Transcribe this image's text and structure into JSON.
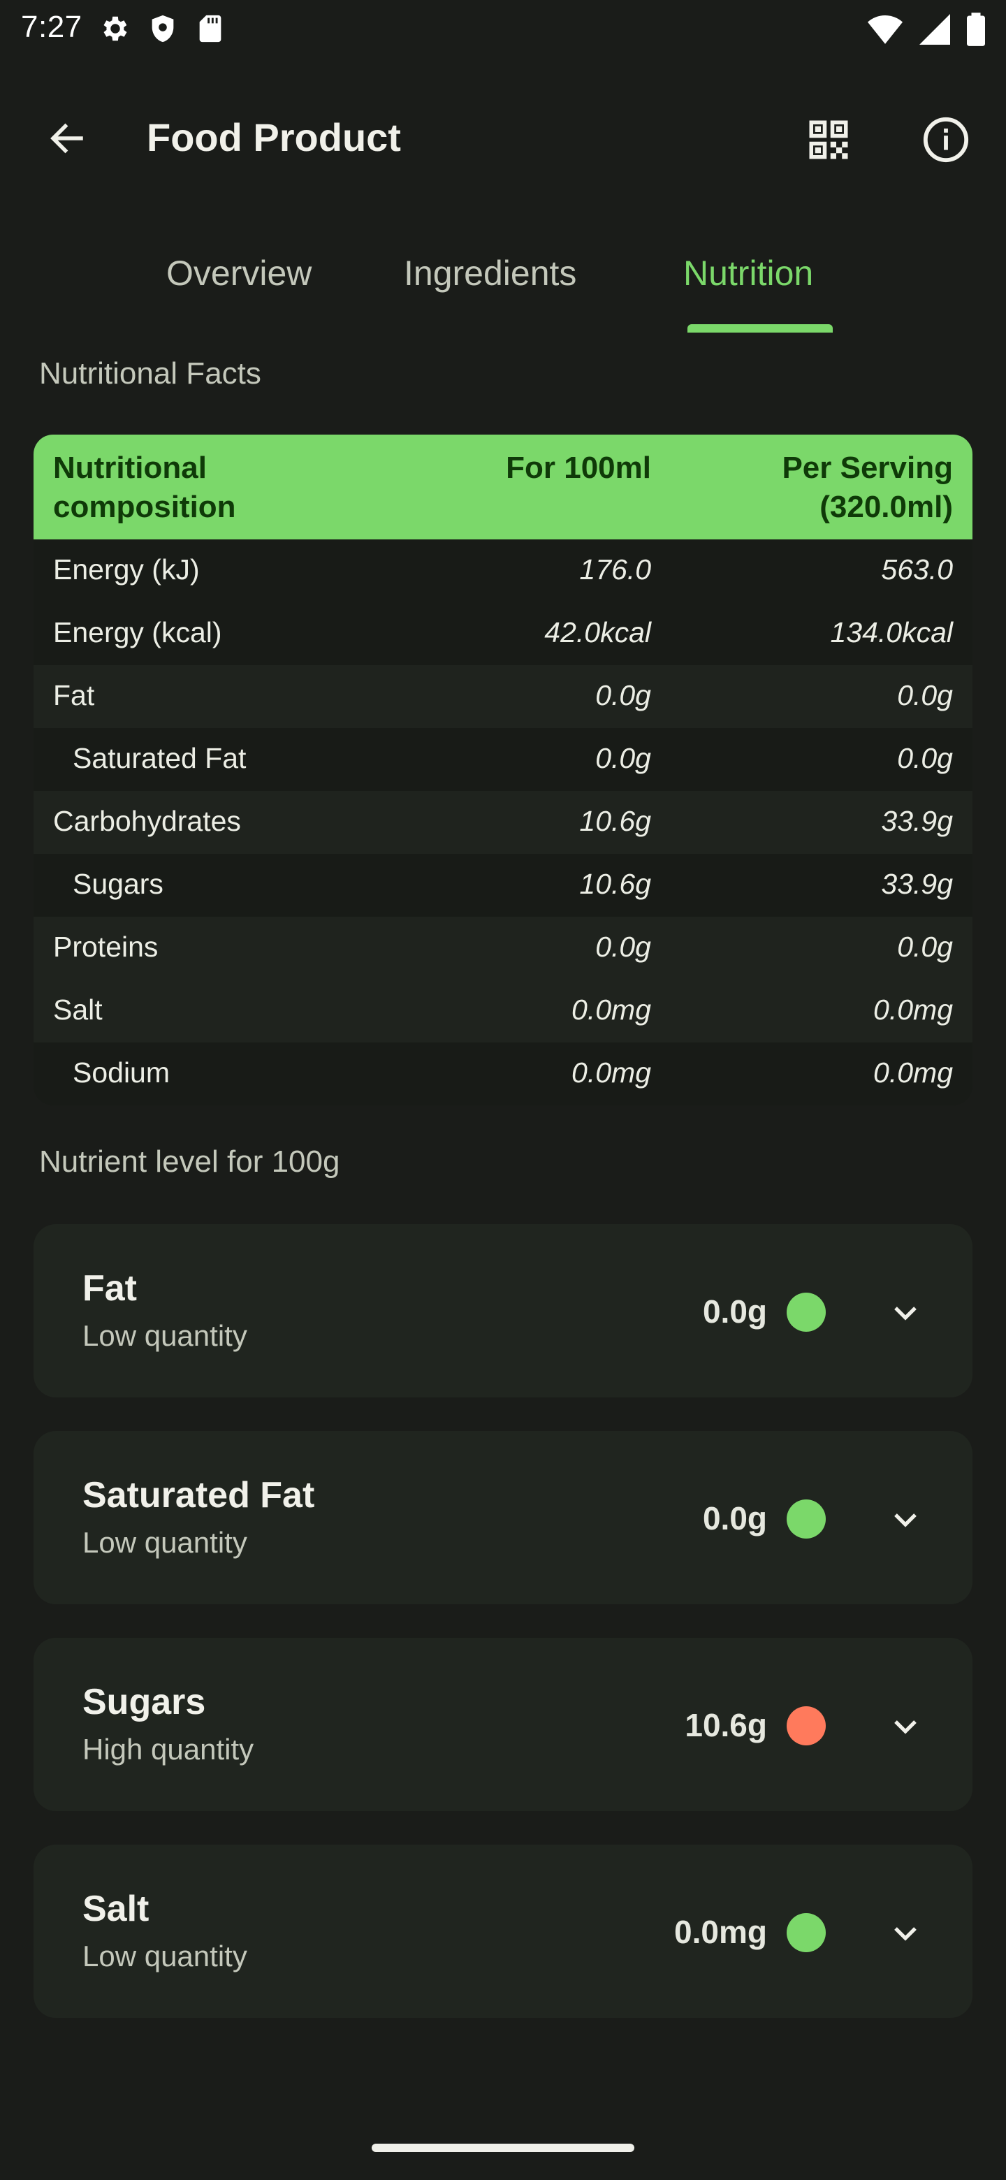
{
  "status_bar": {
    "time": "7:27"
  },
  "app_bar": {
    "title": "Food Product"
  },
  "tabs": [
    {
      "label": "Overview"
    },
    {
      "label": "Ingredients"
    },
    {
      "label": "Nutrition"
    }
  ],
  "active_tab": "Nutrition",
  "nutritional_facts": {
    "section_title": "Nutritional Facts",
    "columns": [
      "Nutritional\ncomposition",
      "For 100ml",
      "Per Serving\n(320.0ml)"
    ],
    "rows": [
      {
        "name": "Energy (kJ)",
        "per_100": "176.0",
        "per_serving": "563.0"
      },
      {
        "name": "Energy (kcal)",
        "per_100": "42.0kcal",
        "per_serving": "134.0kcal"
      },
      {
        "name": "Fat",
        "per_100": "0.0g",
        "per_serving": "0.0g"
      },
      {
        "name": "Saturated Fat",
        "per_100": "0.0g",
        "per_serving": "0.0g"
      },
      {
        "name": "Carbohydrates",
        "per_100": "10.6g",
        "per_serving": "33.9g"
      },
      {
        "name": "Sugars",
        "per_100": "10.6g",
        "per_serving": "33.9g"
      },
      {
        "name": "Proteins",
        "per_100": "0.0g",
        "per_serving": "0.0g"
      },
      {
        "name": "Salt",
        "per_100": "0.0mg",
        "per_serving": "0.0mg"
      },
      {
        "name": "Sodium",
        "per_100": "0.0mg",
        "per_serving": "0.0mg"
      }
    ]
  },
  "nutrient_levels": {
    "section_title": "Nutrient level for 100g",
    "items": [
      {
        "name": "Fat",
        "level": "Low quantity",
        "value": "0.0g",
        "color": "#7bd86a"
      },
      {
        "name": "Saturated Fat",
        "level": "Low quantity",
        "value": "0.0g",
        "color": "#7bd86a"
      },
      {
        "name": "Sugars",
        "level": "High quantity",
        "value": "10.6g",
        "color": "#ff7a5c"
      },
      {
        "name": "Salt",
        "level": "Low quantity",
        "value": "0.0mg",
        "color": "#7bd86a"
      }
    ]
  },
  "colors": {
    "accent": "#7bd86a",
    "background": "#1a1c19",
    "high_level": "#ff7a5c"
  },
  "icons": [
    "settings-icon",
    "shield-icon",
    "sd-card-icon",
    "wifi-icon",
    "signal-icon",
    "battery-icon",
    "back-arrow-icon",
    "qr-code-icon",
    "info-icon",
    "chevron-down-icon"
  ]
}
